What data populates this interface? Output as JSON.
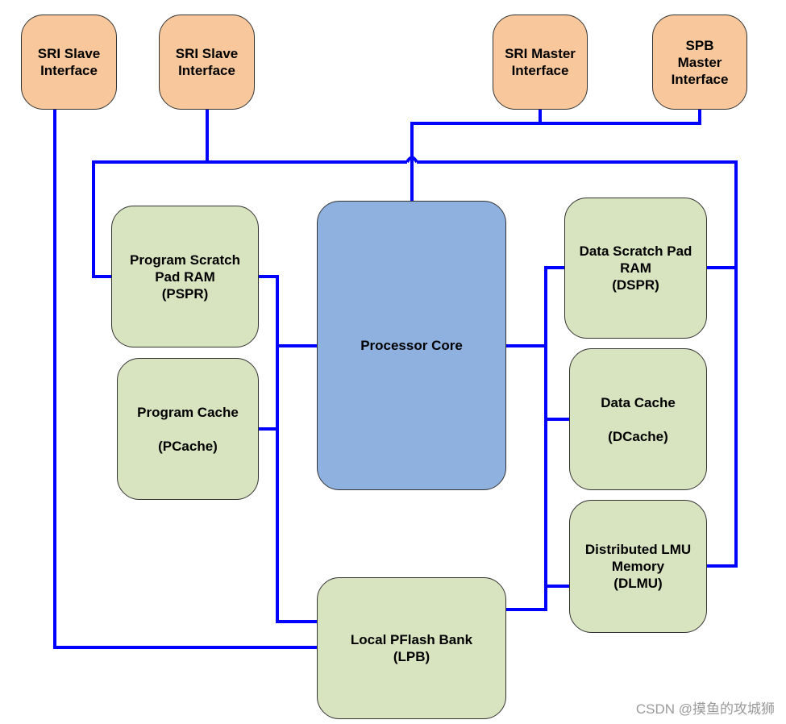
{
  "blocks": {
    "sri_slave_1": "SRI Slave\nInterface",
    "sri_slave_2": "SRI Slave\nInterface",
    "sri_master": "SRI Master\nInterface",
    "spb_master": "SPB\nMaster\nInterface",
    "pspr": "Program Scratch\nPad RAM\n(PSPR)",
    "pcache": "Program Cache\n\n(PCache)",
    "core": "Processor Core",
    "dspr": "Data Scratch Pad\nRAM\n(DSPR)",
    "dcache": "Data Cache\n\n(DCache)",
    "dlmu": "Distributed LMU\nMemory\n(DLMU)",
    "lpb": "Local PFlash Bank\n(LPB)"
  },
  "colors": {
    "interface": "#f8c89c",
    "memory": "#d8e4c0",
    "core": "#8eb1e0",
    "bus": "#0000ff"
  },
  "watermark": "CSDN @摸鱼的攻城狮"
}
